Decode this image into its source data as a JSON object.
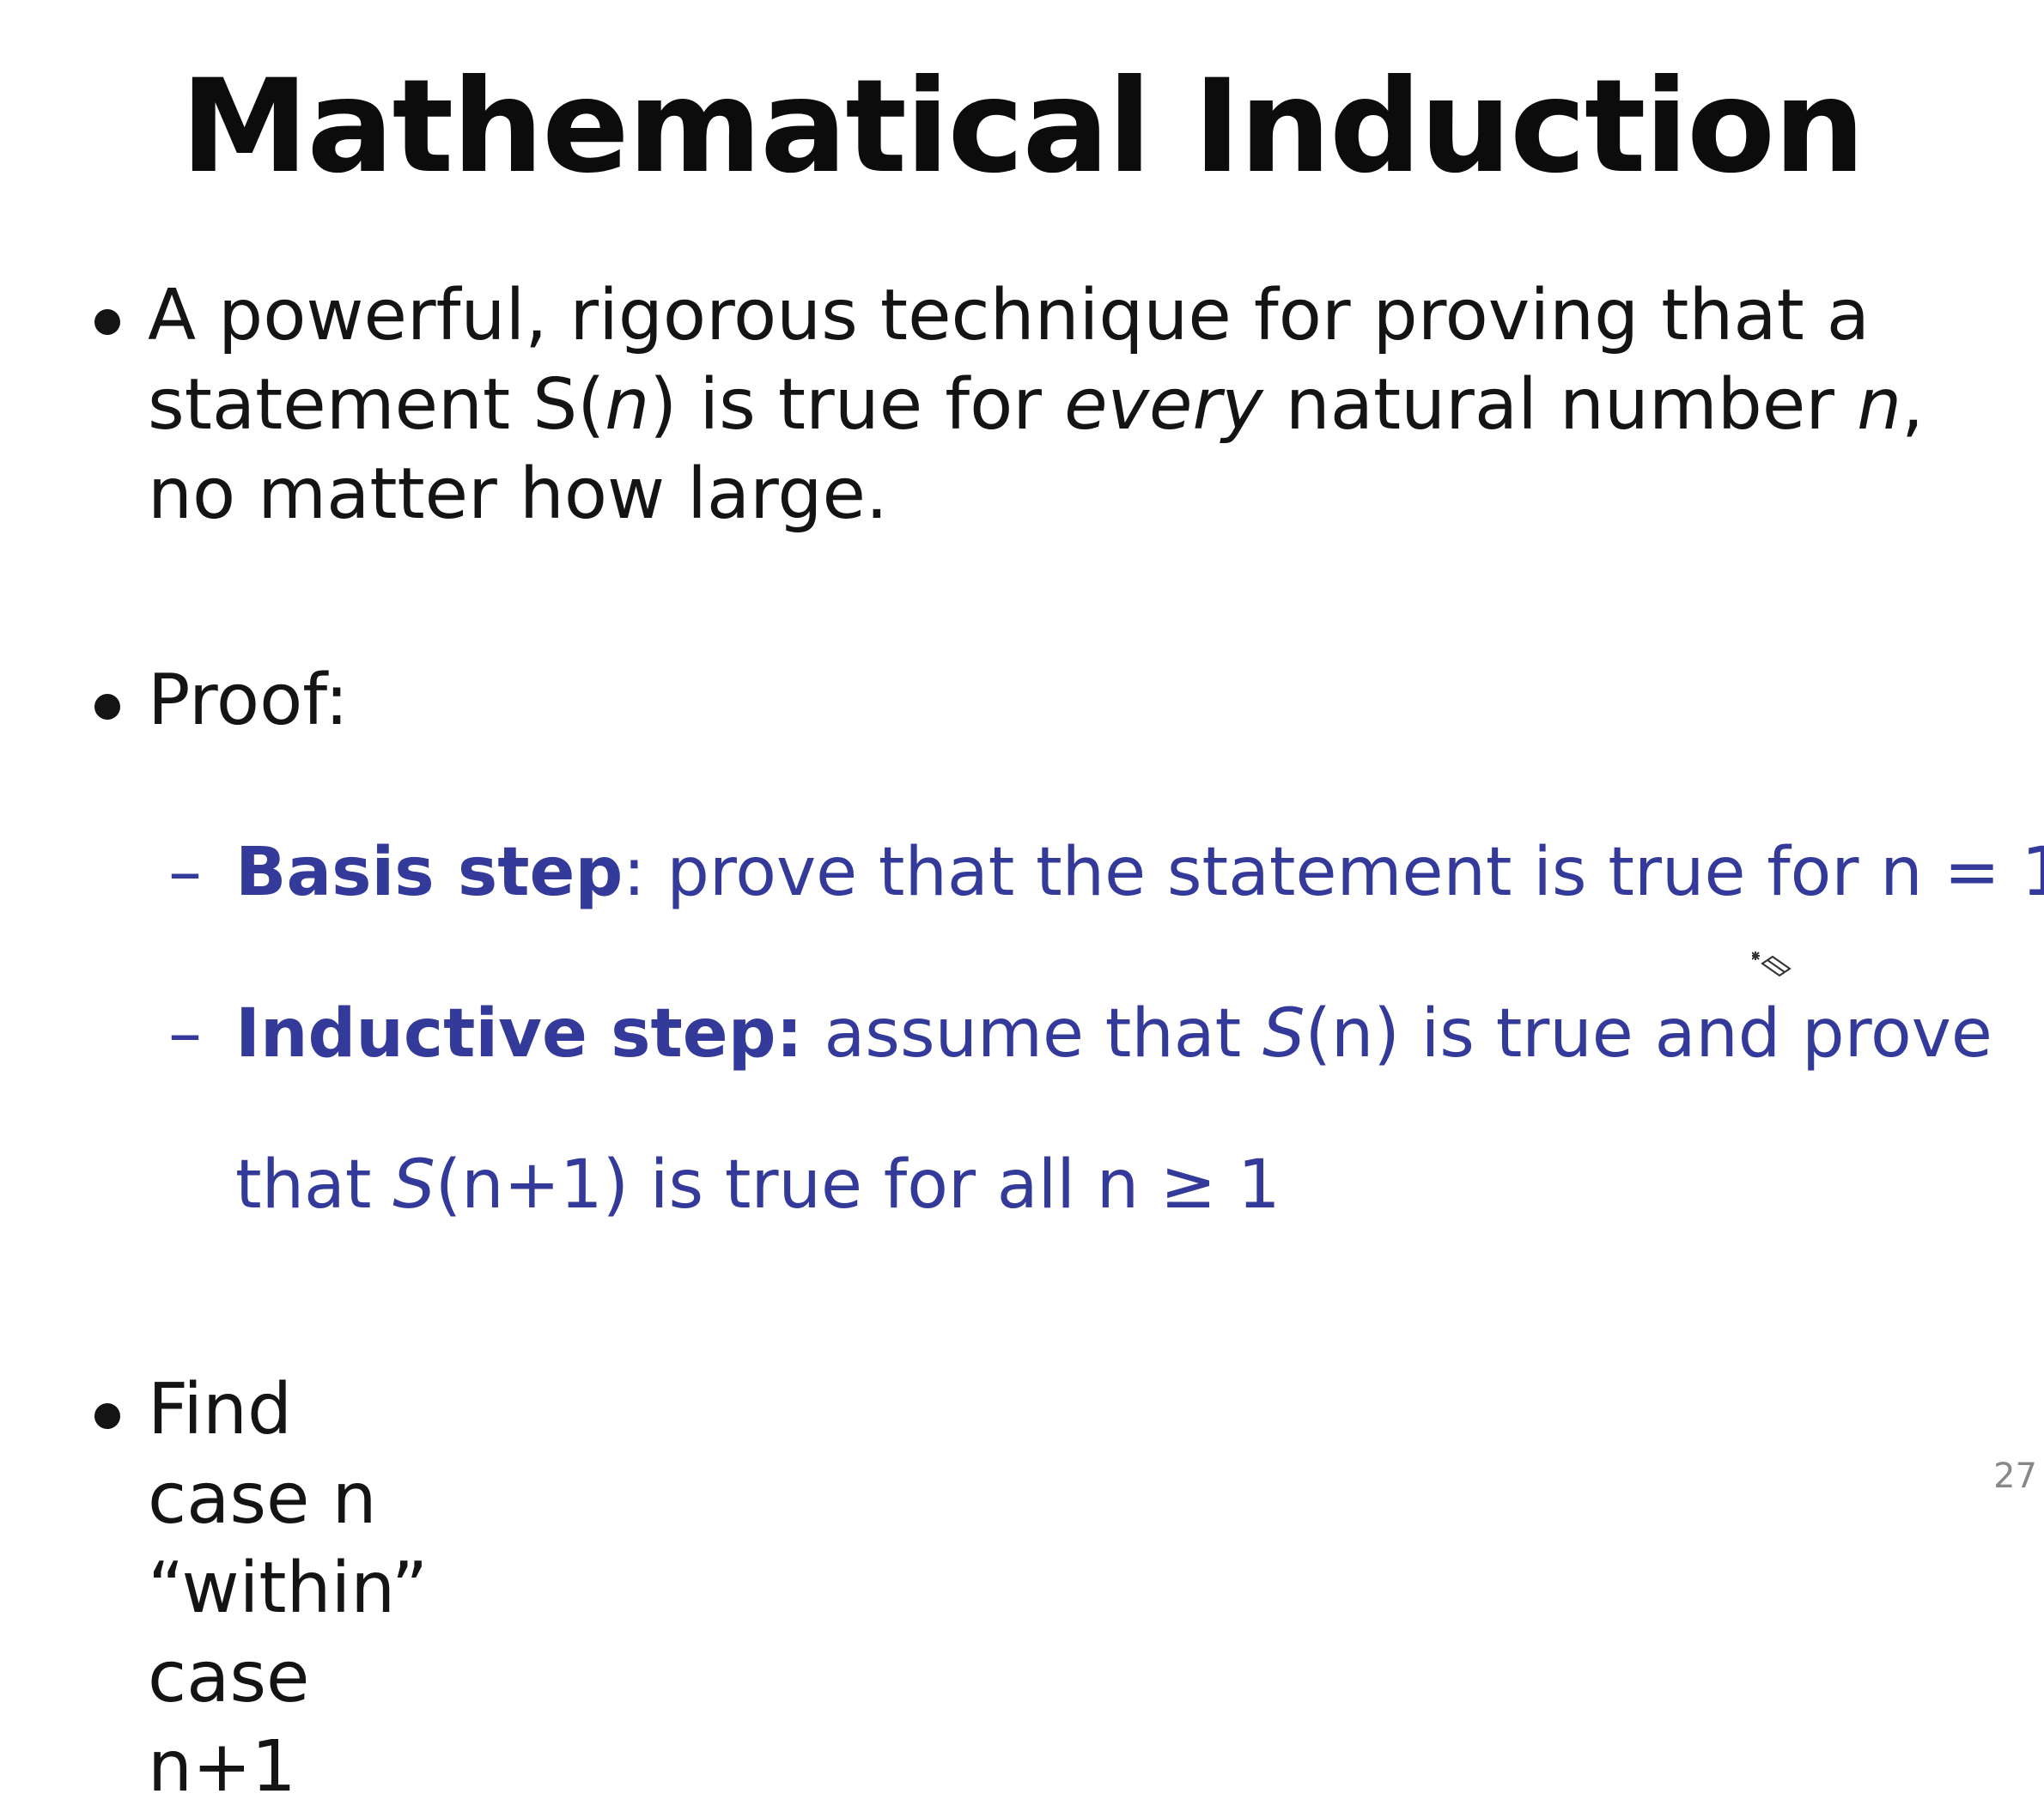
{
  "title": "Mathematical Induction",
  "bullets": {
    "b1": {
      "part1": "A powerful, rigorous technique for proving that a statement S(",
      "n1": "n",
      "part2": ") is true for ",
      "every": "every",
      "part3": " natural number ",
      "n2": "n",
      "part4": ", no matter how large."
    },
    "b2": {
      "text": "Proof:"
    },
    "b3": {
      "part1": "Find case n “within” case n+1"
    }
  },
  "sub": {
    "dash": "–",
    "basis": {
      "label": "Basis step",
      "rest": ": prove that the statement is true for n = 1"
    },
    "inductive": {
      "label": "Inductive step:",
      "rest_a": " assume that ",
      "s1": "S",
      "rest_b": "(n) is true and prove",
      "line2_a": "that ",
      "s2": "S",
      "line2_b": "(n+1) is true for all n ≥ 1"
    }
  },
  "icons": {
    "cursor": "eraser-cursor-icon"
  },
  "page_number": "27"
}
